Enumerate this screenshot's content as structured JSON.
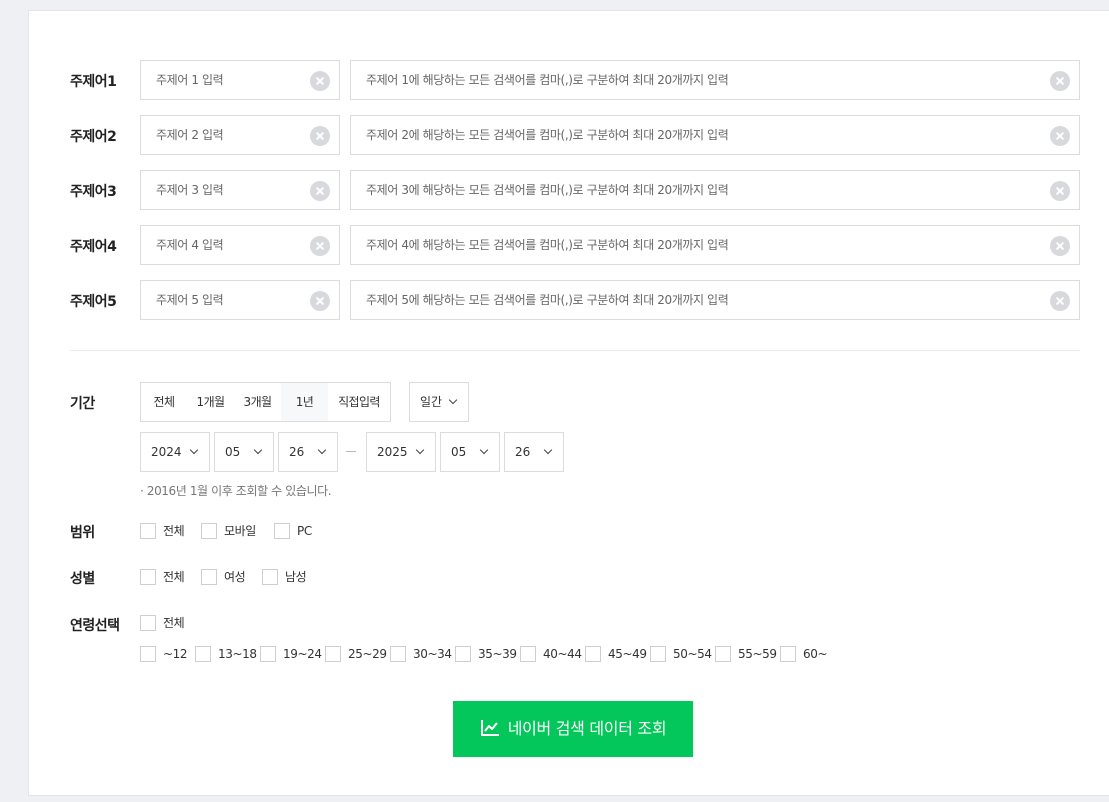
{
  "topics": [
    {
      "label": "주제어1",
      "name_placeholder": "주제어 1 입력",
      "keywords_placeholder": "주제어 1에 해당하는 모든 검색어를 컴마(,)로 구분하여 최대 20개까지 입력"
    },
    {
      "label": "주제어2",
      "name_placeholder": "주제어 2 입력",
      "keywords_placeholder": "주제어 2에 해당하는 모든 검색어를 컴마(,)로 구분하여 최대 20개까지 입력"
    },
    {
      "label": "주제어3",
      "name_placeholder": "주제어 3 입력",
      "keywords_placeholder": "주제어 3에 해당하는 모든 검색어를 컴마(,)로 구분하여 최대 20개까지 입력"
    },
    {
      "label": "주제어4",
      "name_placeholder": "주제어 4 입력",
      "keywords_placeholder": "주제어 4에 해당하는 모든 검색어를 컴마(,)로 구분하여 최대 20개까지 입력"
    },
    {
      "label": "주제어5",
      "name_placeholder": "주제어 5 입력",
      "keywords_placeholder": "주제어 5에 해당하는 모든 검색어를 컴마(,)로 구분하여 최대 20개까지 입력"
    }
  ],
  "period": {
    "label": "기간",
    "options": [
      "전체",
      "1개월",
      "3개월",
      "1년",
      "직접입력"
    ],
    "selected": "1년",
    "unit": "일간",
    "start": {
      "year": "2024",
      "month": "05",
      "day": "26"
    },
    "end": {
      "year": "2025",
      "month": "05",
      "day": "26"
    },
    "note": "· 2016년 1월 이후 조회할 수 있습니다."
  },
  "scope": {
    "label": "범위",
    "options": [
      "전체",
      "모바일",
      "PC"
    ]
  },
  "gender": {
    "label": "성별",
    "options": [
      "전체",
      "여성",
      "남성"
    ]
  },
  "age": {
    "label": "연령선택",
    "all": "전체",
    "options": [
      "~12",
      "13~18",
      "19~24",
      "25~29",
      "30~34",
      "35~39",
      "40~44",
      "45~49",
      "50~54",
      "55~59",
      "60~"
    ]
  },
  "submit": {
    "label": "네이버 검색 데이터 조회"
  },
  "colors": {
    "accent": "#03c75a"
  }
}
